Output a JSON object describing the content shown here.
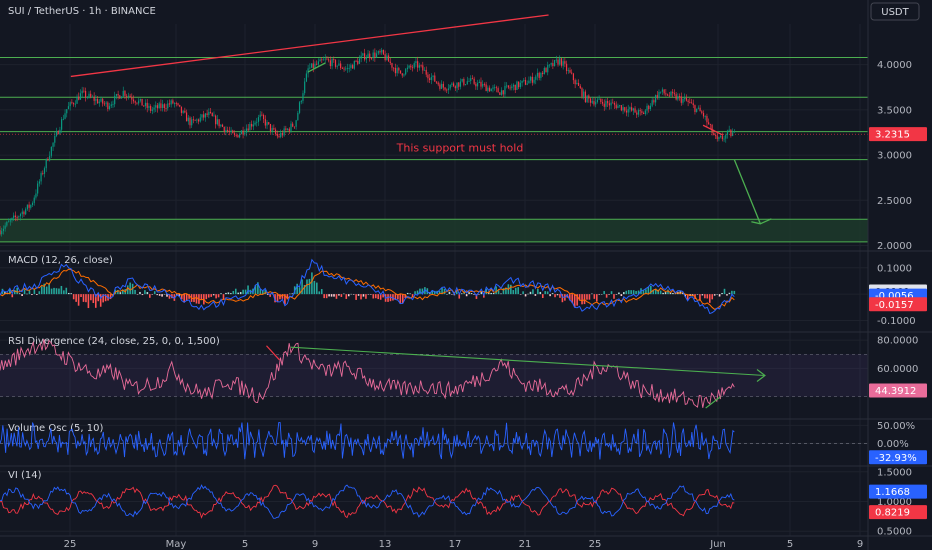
{
  "header": {
    "title": "SUI / TetherUS · 1h · BINANCE",
    "currency": "USDT"
  },
  "colors": {
    "background": "#131722",
    "grid": "#1e222d",
    "text": "#b2b5be",
    "up": "#089981",
    "down": "#f23645",
    "hline": "#4caf50",
    "zone": "#1d3a2a",
    "trend": "#f23645",
    "arrow": "#4caf50",
    "annotation": "#f23645",
    "macd": "#2962ff",
    "signal": "#ff6d00",
    "rsi": "#e96c9a",
    "vol": "#2962ff",
    "viplus": "#2962ff",
    "viminus": "#f23645"
  },
  "chart_data": [
    {
      "type": "candlestick",
      "pane": "price",
      "x_ticks": [
        "25",
        "May",
        "5",
        "9",
        "13",
        "17",
        "21",
        "25",
        "Jun",
        "5",
        "9"
      ],
      "y_ticks": [
        "4.0000",
        "3.5000",
        "3.0000",
        "2.5000",
        "2.0000"
      ],
      "ylim": [
        1.95,
        4.45
      ],
      "last_price": "3.2315",
      "annotation": "This support must hold",
      "horizontal_levels": [
        4.08,
        3.64,
        3.26,
        2.95,
        2.29,
        2.04
      ],
      "zone": [
        2.04,
        2.29
      ],
      "trendline": [
        [
          0.0816,
          3.87
        ],
        [
          0.632,
          4.55
        ]
      ],
      "projection_arrow": [
        [
          0.846,
          2.95
        ],
        [
          0.876,
          2.24
        ]
      ],
      "key_points": [
        [
          0.0,
          2.17
        ],
        [
          0.036,
          2.45
        ],
        [
          0.056,
          3.0
        ],
        [
          0.076,
          3.5
        ],
        [
          0.094,
          3.68
        ],
        [
          0.124,
          3.55
        ],
        [
          0.142,
          3.7
        ],
        [
          0.174,
          3.5
        ],
        [
          0.2,
          3.58
        ],
        [
          0.22,
          3.35
        ],
        [
          0.24,
          3.45
        ],
        [
          0.27,
          3.2
        ],
        [
          0.3,
          3.42
        ],
        [
          0.32,
          3.2
        ],
        [
          0.34,
          3.35
        ],
        [
          0.355,
          3.95
        ],
        [
          0.375,
          4.05
        ],
        [
          0.4,
          3.95
        ],
        [
          0.42,
          4.1
        ],
        [
          0.44,
          4.12
        ],
        [
          0.46,
          3.9
        ],
        [
          0.48,
          4.0
        ],
        [
          0.51,
          3.75
        ],
        [
          0.54,
          3.82
        ],
        [
          0.575,
          3.7
        ],
        [
          0.61,
          3.82
        ],
        [
          0.645,
          4.05
        ],
        [
          0.66,
          3.85
        ],
        [
          0.675,
          3.62
        ],
        [
          0.71,
          3.55
        ],
        [
          0.74,
          3.45
        ],
        [
          0.76,
          3.7
        ],
        [
          0.79,
          3.6
        ],
        [
          0.81,
          3.45
        ],
        [
          0.826,
          3.15
        ],
        [
          0.84,
          3.24
        ],
        [
          0.845,
          3.23
        ]
      ]
    },
    {
      "type": "line",
      "pane": "macd",
      "title": "MACD (12, 26, close)",
      "y_ticks": [
        "0.1000",
        "0.0000",
        "-0.1000"
      ],
      "ylim": [
        -0.14,
        0.16
      ],
      "labels": [
        "0.0101",
        "-0.0056",
        "-0.0157"
      ],
      "series": [
        {
          "key_points": [
            [
              0,
              0.01
            ],
            [
              0.04,
              0.03
            ],
            [
              0.06,
              0.08
            ],
            [
              0.075,
              0.12
            ],
            [
              0.09,
              0.05
            ],
            [
              0.12,
              -0.02
            ],
            [
              0.15,
              0.05
            ],
            [
              0.2,
              0.0
            ],
            [
              0.23,
              -0.05
            ],
            [
              0.27,
              -0.02
            ],
            [
              0.3,
              0.03
            ],
            [
              0.33,
              -0.04
            ],
            [
              0.36,
              0.12
            ],
            [
              0.38,
              0.07
            ],
            [
              0.42,
              0.03
            ],
            [
              0.46,
              -0.03
            ],
            [
              0.5,
              0.02
            ],
            [
              0.55,
              0.0
            ],
            [
              0.59,
              0.05
            ],
            [
              0.64,
              0.02
            ],
            [
              0.67,
              -0.06
            ],
            [
              0.72,
              -0.02
            ],
            [
              0.75,
              0.04
            ],
            [
              0.8,
              -0.02
            ],
            [
              0.82,
              -0.08
            ],
            [
              0.835,
              -0.03
            ],
            [
              0.845,
              0.0
            ]
          ]
        },
        {
          "key_points": [
            [
              0,
              0.0
            ],
            [
              0.04,
              0.02
            ],
            [
              0.06,
              0.05
            ],
            [
              0.08,
              0.1
            ],
            [
              0.1,
              0.06
            ],
            [
              0.13,
              0.0
            ],
            [
              0.16,
              0.03
            ],
            [
              0.2,
              0.01
            ],
            [
              0.24,
              -0.03
            ],
            [
              0.28,
              -0.02
            ],
            [
              0.31,
              0.01
            ],
            [
              0.34,
              -0.02
            ],
            [
              0.37,
              0.09
            ],
            [
              0.4,
              0.06
            ],
            [
              0.44,
              0.02
            ],
            [
              0.48,
              -0.02
            ],
            [
              0.52,
              0.01
            ],
            [
              0.56,
              0.01
            ],
            [
              0.6,
              0.03
            ],
            [
              0.65,
              0.02
            ],
            [
              0.68,
              -0.04
            ],
            [
              0.73,
              -0.02
            ],
            [
              0.76,
              0.02
            ],
            [
              0.8,
              -0.01
            ],
            [
              0.825,
              -0.06
            ],
            [
              0.845,
              -0.015
            ]
          ]
        }
      ]
    },
    {
      "type": "line",
      "pane": "rsi",
      "title": "RSI Divergence (24, close, 25, 0, 0, 1,500)",
      "y_ticks": [
        "80.0000",
        "60.0000"
      ],
      "ylim": [
        25,
        85
      ],
      "labels": [
        "44.3912"
      ],
      "band": [
        40,
        70
      ],
      "divergence_line": [
        [
          0.335,
          75
        ],
        [
          0.82,
          58
        ]
      ],
      "key_points": [
        [
          0,
          60
        ],
        [
          0.03,
          73
        ],
        [
          0.045,
          78
        ],
        [
          0.07,
          70
        ],
        [
          0.09,
          62
        ],
        [
          0.11,
          55
        ],
        [
          0.13,
          58
        ],
        [
          0.15,
          46
        ],
        [
          0.18,
          50
        ],
        [
          0.2,
          60
        ],
        [
          0.22,
          45
        ],
        [
          0.24,
          42
        ],
        [
          0.26,
          52
        ],
        [
          0.28,
          46
        ],
        [
          0.3,
          40
        ],
        [
          0.32,
          60
        ],
        [
          0.335,
          77
        ],
        [
          0.35,
          68
        ],
        [
          0.37,
          58
        ],
        [
          0.4,
          60
        ],
        [
          0.43,
          50
        ],
        [
          0.46,
          45
        ],
        [
          0.49,
          48
        ],
        [
          0.52,
          44
        ],
        [
          0.55,
          52
        ],
        [
          0.58,
          64
        ],
        [
          0.6,
          50
        ],
        [
          0.63,
          46
        ],
        [
          0.66,
          44
        ],
        [
          0.69,
          62
        ],
        [
          0.71,
          60
        ],
        [
          0.74,
          44
        ],
        [
          0.76,
          42
        ],
        [
          0.79,
          38
        ],
        [
          0.81,
          36
        ],
        [
          0.83,
          42
        ],
        [
          0.845,
          44
        ]
      ]
    },
    {
      "type": "line",
      "pane": "volume_osc",
      "title": "Volume Osc (5, 10)",
      "y_ticks": [
        "50.00%",
        "0.00%"
      ],
      "ylim": [
        -60,
        65
      ],
      "labels": [
        "-32.93%"
      ]
    },
    {
      "type": "line",
      "pane": "vortex",
      "title": "VI (14)",
      "y_ticks": [
        "1.5000",
        "1.0000",
        "0.5000"
      ],
      "ylim": [
        0.42,
        1.58
      ],
      "labels": [
        "1.1668",
        "0.8219"
      ]
    }
  ]
}
